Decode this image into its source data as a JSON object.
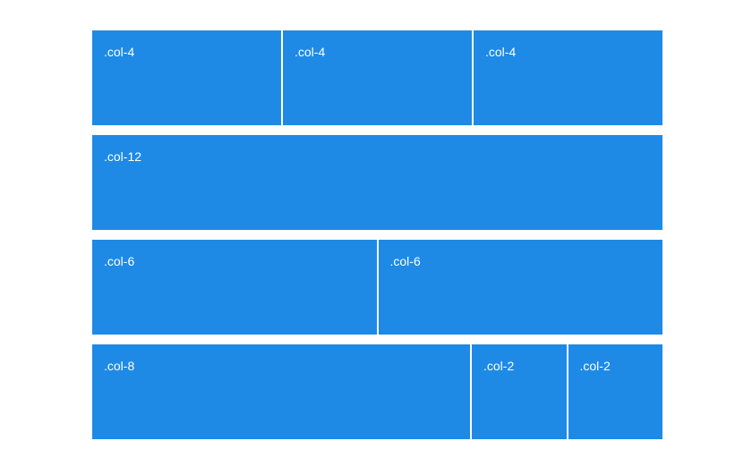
{
  "theme": {
    "cell_color": "#1e8ae6",
    "text_color": "#ffffff",
    "background": "#ffffff"
  },
  "rows": [
    {
      "cells": [
        {
          "label": ".col-4"
        },
        {
          "label": ".col-4"
        },
        {
          "label": ".col-4"
        }
      ]
    },
    {
      "cells": [
        {
          "label": ".col-12"
        }
      ]
    },
    {
      "cells": [
        {
          "label": ".col-6"
        },
        {
          "label": ".col-6"
        }
      ]
    },
    {
      "cells": [
        {
          "label": ".col-8"
        },
        {
          "label": ".col-2"
        },
        {
          "label": ".col-2"
        }
      ]
    }
  ]
}
